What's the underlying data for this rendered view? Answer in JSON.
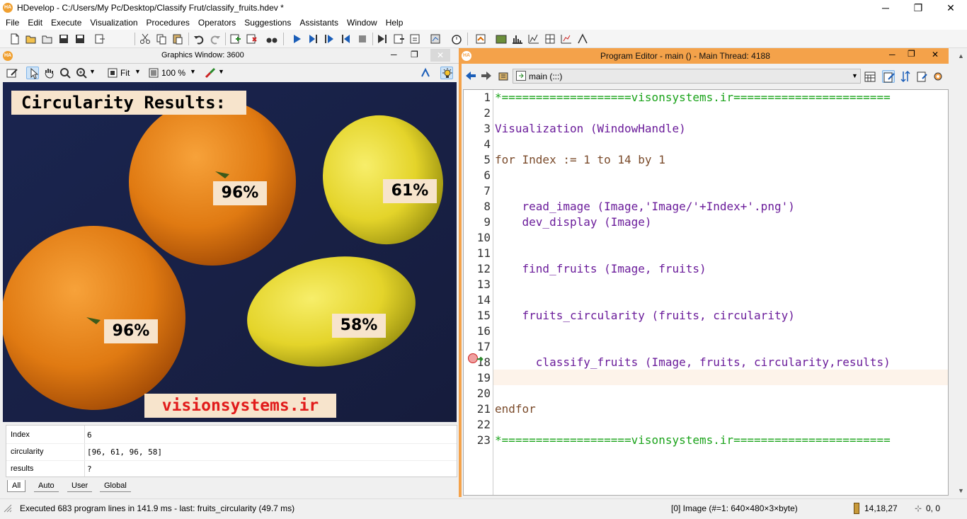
{
  "window": {
    "logo": "HA",
    "title": "HDevelop - C:/Users/My Pc/Desktop/Classify Frut/classify_fruits.hdev *",
    "minimize": "─",
    "restore": "❐",
    "close": "✕"
  },
  "menu": [
    "File",
    "Edit",
    "Execute",
    "Visualization",
    "Procedures",
    "Operators",
    "Suggestions",
    "Assistants",
    "Window",
    "Help"
  ],
  "graphics_window": {
    "title": "Graphics Window: 3600",
    "zoom_fit": "Fit",
    "zoom_percent": "100 %",
    "image": {
      "heading": "Circularity Results:",
      "labels": [
        "96%",
        "61%",
        "96%",
        "58%"
      ],
      "watermark": "visionsystems.ir"
    }
  },
  "variables": {
    "rows": [
      {
        "name": "Index",
        "value": "6"
      },
      {
        "name": "circularity",
        "value": "[96, 61, 96, 58]"
      },
      {
        "name": "results",
        "value": "?"
      }
    ],
    "tabs": [
      "All",
      "Auto",
      "User",
      "Global"
    ]
  },
  "program_editor": {
    "title": "Program Editor - main () - Main Thread: 4188",
    "procedure": "main (:::)",
    "lines": [
      {
        "n": "1",
        "text": "*===================visonsystems.ir=======================",
        "kind": "comment"
      },
      {
        "n": "2",
        "text": "",
        "kind": "plain"
      },
      {
        "n": "3",
        "text": "Visualization (WindowHandle)",
        "kind": "proc"
      },
      {
        "n": "4",
        "text": "",
        "kind": "plain"
      },
      {
        "n": "5",
        "text": "for Index := 1 to 14 by 1",
        "kind": "control"
      },
      {
        "n": "6",
        "text": "",
        "kind": "plain"
      },
      {
        "n": "7",
        "text": "",
        "kind": "plain"
      },
      {
        "n": "8",
        "text": "    read_image (Image,'Image/'+Index+'.png')",
        "kind": "op"
      },
      {
        "n": "9",
        "text": "    dev_display (Image)",
        "kind": "op"
      },
      {
        "n": "10",
        "text": "",
        "kind": "plain"
      },
      {
        "n": "11",
        "text": "",
        "kind": "plain"
      },
      {
        "n": "12",
        "text": "    find_fruits (Image, fruits)",
        "kind": "proc"
      },
      {
        "n": "13",
        "text": "",
        "kind": "plain"
      },
      {
        "n": "14",
        "text": "",
        "kind": "plain"
      },
      {
        "n": "15",
        "text": "    fruits_circularity (fruits, circularity)",
        "kind": "proc"
      },
      {
        "n": "16",
        "text": "",
        "kind": "plain"
      },
      {
        "n": "17",
        "text": "",
        "kind": "plain"
      },
      {
        "n": "18",
        "text": "      classify_fruits (Image, fruits, circularity,results)",
        "kind": "proc"
      },
      {
        "n": "19",
        "text": "",
        "kind": "plain"
      },
      {
        "n": "20",
        "text": "",
        "kind": "plain"
      },
      {
        "n": "21",
        "text": "endfor",
        "kind": "control"
      },
      {
        "n": "22",
        "text": "",
        "kind": "plain"
      },
      {
        "n": "23",
        "text": "*===================visonsystems.ir=======================",
        "kind": "comment"
      }
    ]
  },
  "status": {
    "message": "Executed 683 program lines in 141.9 ms - last: fruits_circularity (49.7 ms)",
    "image_info": "[0] Image (#=1: 640×480×3×byte)",
    "pixel_value": "14,18,27",
    "coords": "0, 0"
  },
  "colors": {
    "accent_orange": "#f4a24a",
    "comment": "#1aa31a",
    "control": "#7a4a2a",
    "operator": "#6a1b9a",
    "procedure": "#6a1b9a"
  },
  "icons": [
    "new-file-icon",
    "open-file-icon",
    "save-icon",
    "cut-icon",
    "copy-icon",
    "paste-icon",
    "undo-icon",
    "redo-icon",
    "run-icon",
    "step-icon",
    "stop-icon",
    "zoom-icon",
    "pan-icon",
    "pointer-icon",
    "lamp-icon"
  ]
}
